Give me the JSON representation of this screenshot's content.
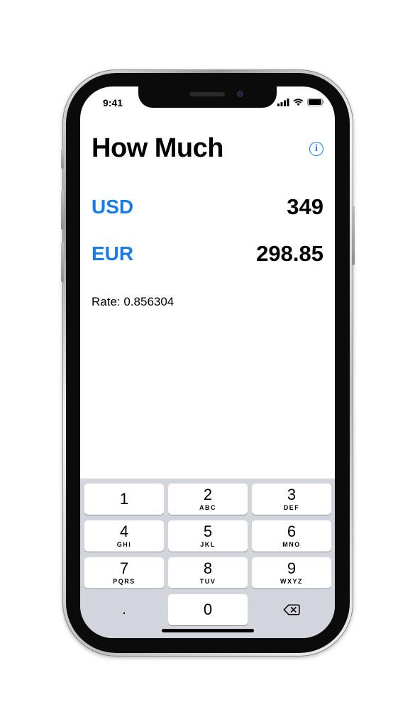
{
  "status_bar": {
    "time": "9:41"
  },
  "app": {
    "title": "How Much",
    "info_icon_glyph": "i",
    "accent_color": "#1a7ce8"
  },
  "conversion": {
    "from": {
      "code": "USD",
      "value": "349"
    },
    "to": {
      "code": "EUR",
      "value": "298.85"
    },
    "rate_text": "Rate: 0.856304"
  },
  "keypad": {
    "keys": [
      {
        "num": "1",
        "letters": ""
      },
      {
        "num": "2",
        "letters": "ABC"
      },
      {
        "num": "3",
        "letters": "DEF"
      },
      {
        "num": "4",
        "letters": "GHI"
      },
      {
        "num": "5",
        "letters": "JKL"
      },
      {
        "num": "6",
        "letters": "MNO"
      },
      {
        "num": "7",
        "letters": "PQRS"
      },
      {
        "num": "8",
        "letters": "TUV"
      },
      {
        "num": "9",
        "letters": "WXYZ"
      }
    ],
    "decimal": ".",
    "zero": "0",
    "delete_icon": "backspace-icon"
  }
}
